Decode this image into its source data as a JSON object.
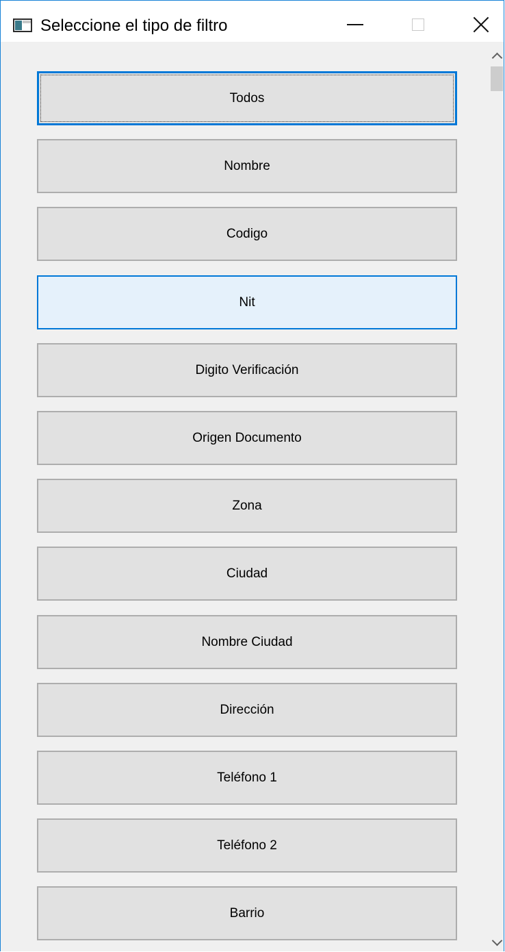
{
  "window": {
    "title": "Seleccione el tipo de filtro",
    "icon": "app-window-icon"
  },
  "titlebar": {
    "minimize_icon": "minimize-icon",
    "maximize_icon": "maximize-icon",
    "close_icon": "close-icon",
    "maximize_enabled": false
  },
  "filters": [
    {
      "label": "Todos",
      "state": "focused"
    },
    {
      "label": "Nombre",
      "state": "normal"
    },
    {
      "label": "Codigo",
      "state": "normal"
    },
    {
      "label": "Nit",
      "state": "hover"
    },
    {
      "label": "Digito Verificación",
      "state": "normal"
    },
    {
      "label": "Origen Documento",
      "state": "normal"
    },
    {
      "label": "Zona",
      "state": "normal"
    },
    {
      "label": "Ciudad",
      "state": "normal"
    },
    {
      "label": "Nombre Ciudad",
      "state": "normal"
    },
    {
      "label": "Dirección",
      "state": "normal"
    },
    {
      "label": "Teléfono 1",
      "state": "normal"
    },
    {
      "label": "Teléfono 2",
      "state": "normal"
    },
    {
      "label": "Barrio",
      "state": "normal"
    }
  ],
  "scrollbar": {
    "up_icon": "chevron-up-icon",
    "down_icon": "chevron-down-icon",
    "position": 0
  },
  "colors": {
    "focus_border": "#0078d7",
    "hover_background": "#e5f1fb",
    "button_background": "#e1e1e1",
    "window_border": "#1883d7"
  }
}
